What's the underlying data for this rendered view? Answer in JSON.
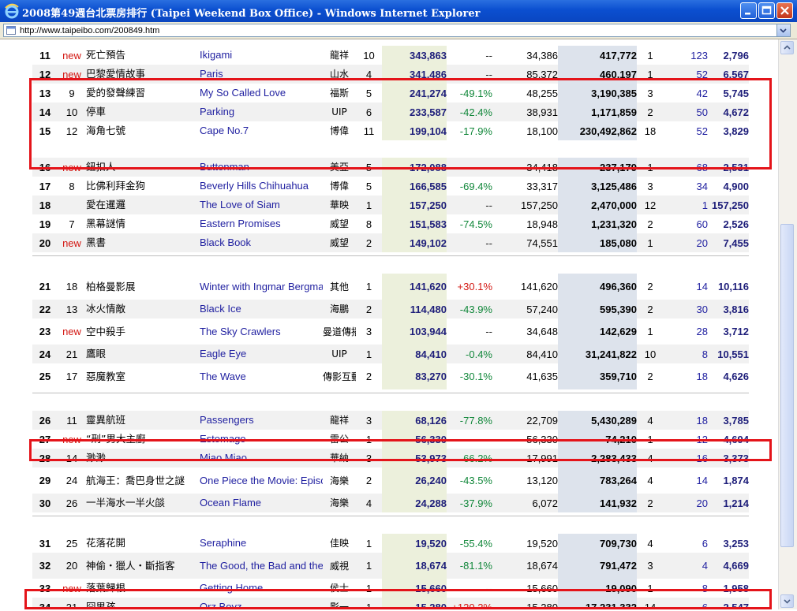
{
  "window": {
    "title": "2008第49週台北票房排行 (Taipei Weekend Box Office) - Windows Internet Explorer",
    "address": "http://www.taipeibo.com/200849.htm"
  },
  "colors": {
    "new_label": "#d31712",
    "english_title": "#1f1fa0",
    "change_down": "#11873a",
    "change_up": "#d31712",
    "highlight_box": "#e4141a"
  },
  "rows": [
    {
      "rank": "11",
      "prev": "new",
      "zh": "死亡預告",
      "en": "Ikigami",
      "dist": "龍祥",
      "wk": "10",
      "gross": "343,863",
      "chg": "--",
      "avg": "34,386",
      "cum": "417,772",
      "wks": "1",
      "scr": "123",
      "pavg": "2,796"
    },
    {
      "rank": "12",
      "prev": "new",
      "zh": "巴黎愛情故事",
      "en": "Paris",
      "dist": "山水",
      "wk": "4",
      "gross": "341,486",
      "chg": "--",
      "avg": "85,372",
      "cum": "460,197",
      "wks": "1",
      "scr": "52",
      "pavg": "6,567"
    },
    {
      "rank": "13",
      "prev": "9",
      "zh": "愛的發聲練習",
      "en": "My So Called Love",
      "dist": "福斯",
      "wk": "5",
      "gross": "241,274",
      "chg": "-49.1%",
      "avg": "48,255",
      "cum": "3,190,385",
      "wks": "3",
      "scr": "42",
      "pavg": "5,745"
    },
    {
      "rank": "14",
      "prev": "10",
      "zh": "停車",
      "en": "Parking",
      "dist": "UIP",
      "wk": "6",
      "gross": "233,587",
      "chg": "-42.4%",
      "avg": "38,931",
      "cum": "1,171,859",
      "wks": "2",
      "scr": "50",
      "pavg": "4,672"
    },
    {
      "rank": "15",
      "prev": "12",
      "zh": "海角七號",
      "en": "Cape No.7",
      "dist": "博偉",
      "wk": "11",
      "gross": "199,104",
      "chg": "-17.9%",
      "avg": "18,100",
      "cum": "230,492,862",
      "wks": "18",
      "scr": "52",
      "pavg": "3,829"
    },
    {
      "rank": "16",
      "prev": "new",
      "zh": "鈕扣人",
      "en": "Buttonman",
      "dist": "美亞",
      "wk": "5",
      "gross": "172,088",
      "chg": "--",
      "avg": "34,418",
      "cum": "237,179",
      "wks": "1",
      "scr": "68",
      "pavg": "2,531"
    },
    {
      "rank": "17",
      "prev": "8",
      "zh": "比佛利拜金狗",
      "en": "Beverly Hills Chihuahua",
      "dist": "博偉",
      "wk": "5",
      "gross": "166,585",
      "chg": "-69.4%",
      "avg": "33,317",
      "cum": "3,125,486",
      "wks": "3",
      "scr": "34",
      "pavg": "4,900"
    },
    {
      "rank": "18",
      "prev": "",
      "zh": "愛在暹邏",
      "en": "The Love of Siam",
      "dist": "華映",
      "wk": "1",
      "gross": "157,250",
      "chg": "--",
      "avg": "157,250",
      "cum": "2,470,000",
      "wks": "12",
      "scr": "1",
      "pavg": "157,250"
    },
    {
      "rank": "19",
      "prev": "7",
      "zh": "黑幕謎情",
      "en": "Eastern Promises",
      "dist": "威望",
      "wk": "8",
      "gross": "151,583",
      "chg": "-74.5%",
      "avg": "18,948",
      "cum": "1,231,320",
      "wks": "2",
      "scr": "60",
      "pavg": "2,526"
    },
    {
      "rank": "20",
      "prev": "new",
      "zh": "黑書",
      "en": "Black Book",
      "dist": "威望",
      "wk": "2",
      "gross": "149,102",
      "chg": "--",
      "avg": "74,551",
      "cum": "185,080",
      "wks": "1",
      "scr": "20",
      "pavg": "7,455"
    },
    {
      "rank": "21",
      "prev": "18",
      "zh": "柏格曼影展",
      "en": "Winter with Ingmar Bergman Film Festival",
      "dist": "其他",
      "wk": "1",
      "gross": "141,620",
      "chg": "+30.1%",
      "avg": "141,620",
      "cum": "496,360",
      "wks": "2",
      "scr": "14",
      "pavg": "10,116"
    },
    {
      "rank": "22",
      "prev": "13",
      "zh": "冰火情敵",
      "en": "Black Ice",
      "dist": "海鵬",
      "wk": "2",
      "gross": "114,480",
      "chg": "-43.9%",
      "avg": "57,240",
      "cum": "595,390",
      "wks": "2",
      "scr": "30",
      "pavg": "3,816"
    },
    {
      "rank": "23",
      "prev": "new",
      "zh": "空中殺手",
      "en": "The Sky Crawlers",
      "dist": "曼道傳播",
      "wk": "3",
      "gross": "103,944",
      "chg": "--",
      "avg": "34,648",
      "cum": "142,629",
      "wks": "1",
      "scr": "28",
      "pavg": "3,712"
    },
    {
      "rank": "24",
      "prev": "21",
      "zh": "鷹眼",
      "en": "Eagle Eye",
      "dist": "UIP",
      "wk": "1",
      "gross": "84,410",
      "chg": "-0.4%",
      "avg": "84,410",
      "cum": "31,241,822",
      "wks": "10",
      "scr": "8",
      "pavg": "10,551"
    },
    {
      "rank": "25",
      "prev": "17",
      "zh": "惡魔教室",
      "en": "The Wave",
      "dist": "傳影互動",
      "wk": "2",
      "gross": "83,270",
      "chg": "-30.1%",
      "avg": "41,635",
      "cum": "359,710",
      "wks": "2",
      "scr": "18",
      "pavg": "4,626"
    },
    {
      "rank": "26",
      "prev": "11",
      "zh": "靈異航班",
      "en": "Passengers",
      "dist": "龍祥",
      "wk": "3",
      "gross": "68,126",
      "chg": "-77.8%",
      "avg": "22,709",
      "cum": "5,430,289",
      "wks": "4",
      "scr": "18",
      "pavg": "3,785"
    },
    {
      "rank": "27",
      "prev": "new",
      "zh": "“刑”男大主廚",
      "en": "Estomago",
      "dist": "雷公",
      "wk": "1",
      "gross": "56,330",
      "chg": "--",
      "avg": "56,330",
      "cum": "74,210",
      "wks": "1",
      "scr": "12",
      "pavg": "4,694"
    },
    {
      "rank": "28",
      "prev": "14",
      "zh": "渺渺",
      "en": "Miao Miao",
      "dist": "華納",
      "wk": "3",
      "gross": "53,973",
      "chg": "-66.2%",
      "avg": "17,991",
      "cum": "2,283,433",
      "wks": "4",
      "scr": "16",
      "pavg": "3,373"
    },
    {
      "rank": "29",
      "prev": "24",
      "zh": "航海王：喬巴身世之謎",
      "en": "One Piece the Movie: Episode of Chopper",
      "dist": "海樂",
      "wk": "2",
      "gross": "26,240",
      "chg": "-43.5%",
      "avg": "13,120",
      "cum": "783,264",
      "wks": "4",
      "scr": "14",
      "pavg": "1,874"
    },
    {
      "rank": "30",
      "prev": "26",
      "zh": "一半海水一半火燄",
      "en": "Ocean Flame",
      "dist": "海樂",
      "wk": "4",
      "gross": "24,288",
      "chg": "-37.9%",
      "avg": "6,072",
      "cum": "141,932",
      "wks": "2",
      "scr": "20",
      "pavg": "1,214"
    },
    {
      "rank": "31",
      "prev": "25",
      "zh": "花落花開",
      "en": "Seraphine",
      "dist": "佳映",
      "wk": "1",
      "gross": "19,520",
      "chg": "-55.4%",
      "avg": "19,520",
      "cum": "709,730",
      "wks": "4",
      "scr": "6",
      "pavg": "3,253"
    },
    {
      "rank": "32",
      "prev": "20",
      "zh": "神偷・獵人・斷指客",
      "en": "The Good, the Bad and the Weird",
      "dist": "威視",
      "wk": "1",
      "gross": "18,674",
      "chg": "-81.1%",
      "avg": "18,674",
      "cum": "791,472",
      "wks": "3",
      "scr": "4",
      "pavg": "4,669"
    },
    {
      "rank": "33",
      "prev": "new",
      "zh": "落葉歸根",
      "en": "Getting Home",
      "dist": "侯士",
      "wk": "1",
      "gross": "15,660",
      "chg": "--",
      "avg": "15,660",
      "cum": "19,090",
      "wks": "1",
      "scr": "8",
      "pavg": "1,958"
    },
    {
      "rank": "34",
      "prev": "31",
      "zh": "囧男孩",
      "en": "Orz Boyz",
      "dist": "影一",
      "wk": "1",
      "gross": "15,280",
      "chg": "+120.2%",
      "avg": "15,280",
      "cum": "17,231,332",
      "wks": "14",
      "scr": "6",
      "pavg": "2,547"
    }
  ]
}
